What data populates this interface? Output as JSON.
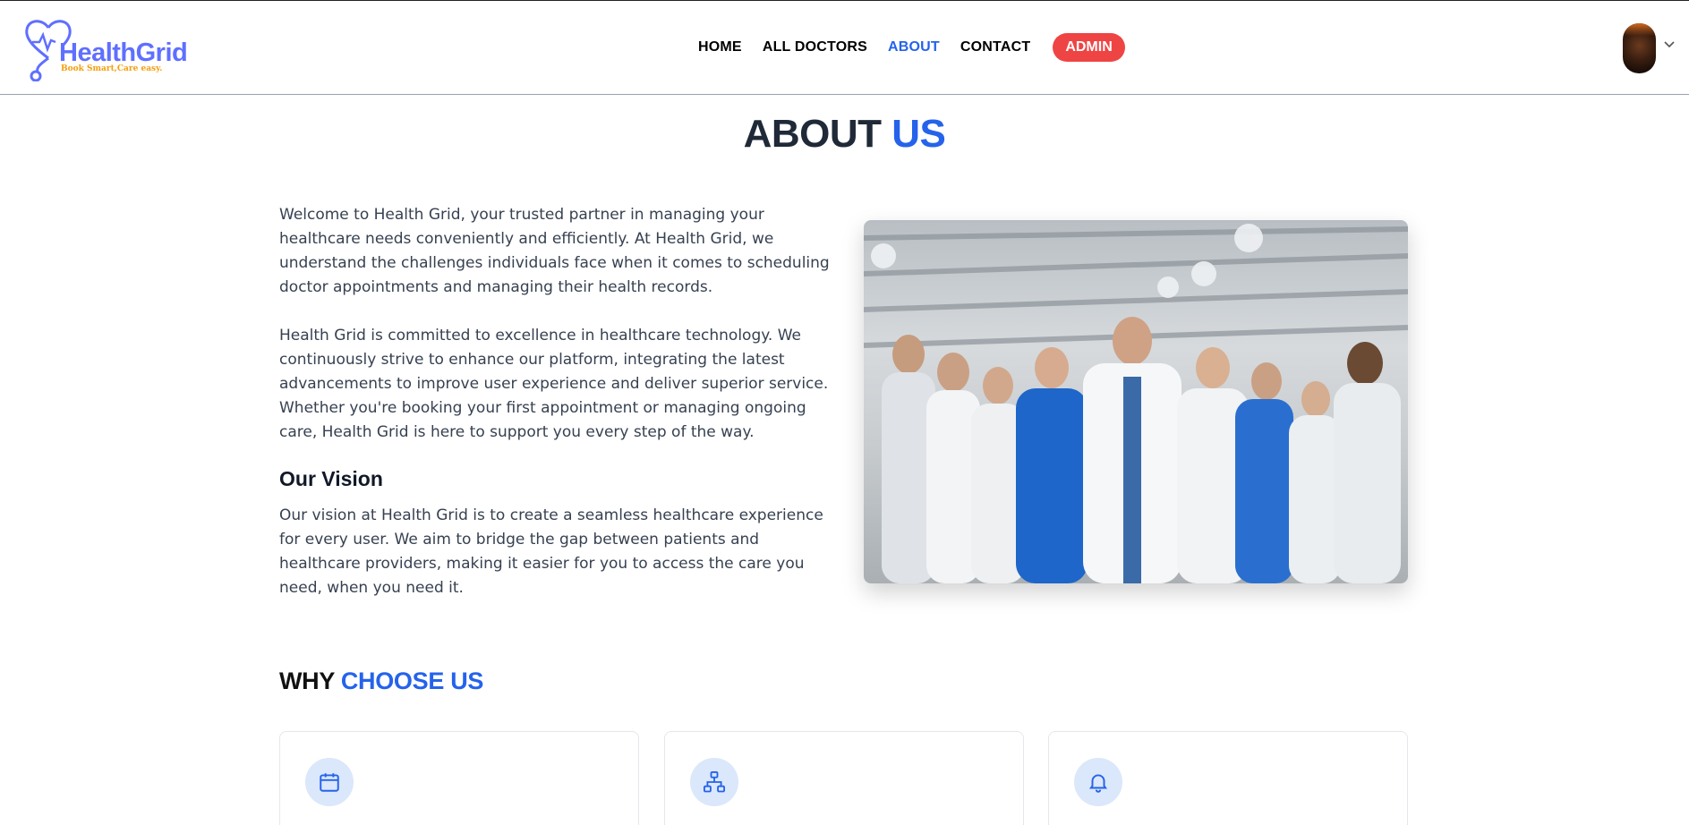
{
  "brand": {
    "name": "HealthGrid",
    "tagline": "Book Smart,Care easy."
  },
  "nav": {
    "items": [
      {
        "label": "HOME",
        "active": false
      },
      {
        "label": "ALL DOCTORS",
        "active": false
      },
      {
        "label": "ABOUT",
        "active": true
      },
      {
        "label": "CONTACT",
        "active": false
      }
    ],
    "admin_label": "ADMIN"
  },
  "page": {
    "title_main": "ABOUT",
    "title_accent": "US"
  },
  "about": {
    "paragraph1": "Welcome to Health Grid, your trusted partner in managing your healthcare needs conveniently and efficiently. At Health Grid, we understand the challenges individuals face when it comes to scheduling doctor appointments and managing their health records.",
    "paragraph2": "Health Grid is committed to excellence in healthcare technology. We continuously strive to enhance our platform, integrating the latest advancements to improve user experience and deliver superior service. Whether you're booking your first appointment or managing ongoing care, Health Grid is here to support you every step of the way.",
    "vision_title": "Our Vision",
    "vision_text": "Our vision at Health Grid is to create a seamless healthcare experience for every user. We aim to bridge the gap between patients and healthcare providers, making it easier for you to access the care you need, when you need it."
  },
  "why": {
    "title_main": "WHY",
    "title_accent": "CHOOSE US",
    "cards": [
      {
        "icon": "calendar-icon"
      },
      {
        "icon": "network-icon"
      },
      {
        "icon": "bell-icon"
      }
    ]
  },
  "colors": {
    "accent": "#2563eb",
    "brand": "#5f6fff",
    "admin": "#ef4444",
    "tagline": "#f59e0b",
    "icon_bg": "#dbe7fb"
  }
}
